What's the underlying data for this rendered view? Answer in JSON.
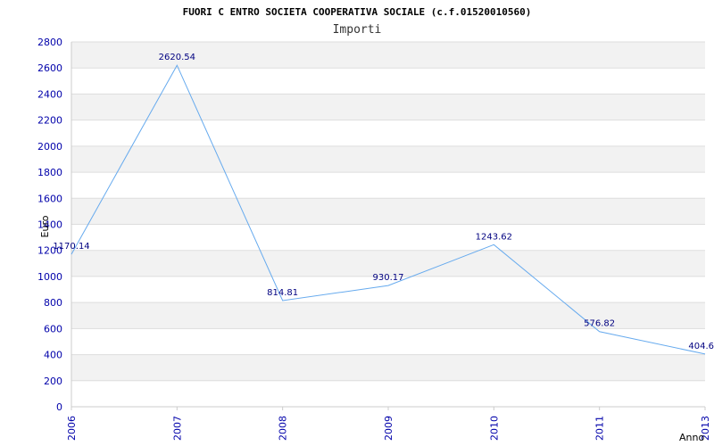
{
  "chart_data": {
    "type": "line",
    "title": "FUORI C ENTRO SOCIETA COOPERATIVA SOCIALE (c.f.01520010560)",
    "subtitle": "Importi",
    "xlabel": "Anno",
    "ylabel": "Euro",
    "categories": [
      "2006",
      "2007",
      "2008",
      "2009",
      "2010",
      "2011",
      "2013"
    ],
    "series": [
      {
        "values": [
          1170.14,
          2620.54,
          814.81,
          930.17,
          1243.62,
          576.82,
          404.6
        ]
      }
    ],
    "data_labels": [
      "1170.14",
      "2620.54",
      "814.81",
      "930.17",
      "1243.62",
      "576.82",
      "404.6"
    ],
    "ylim": [
      0,
      2800
    ],
    "yticks": [
      0,
      200,
      400,
      600,
      800,
      1000,
      1200,
      1400,
      1600,
      1800,
      2000,
      2200,
      2400,
      2600,
      2800
    ],
    "grid": true,
    "legend": "none",
    "colors": {
      "line": "#66aaee",
      "band": "#f2f2f2",
      "tick_text": "#0000aa",
      "label_text": "#000080"
    }
  }
}
